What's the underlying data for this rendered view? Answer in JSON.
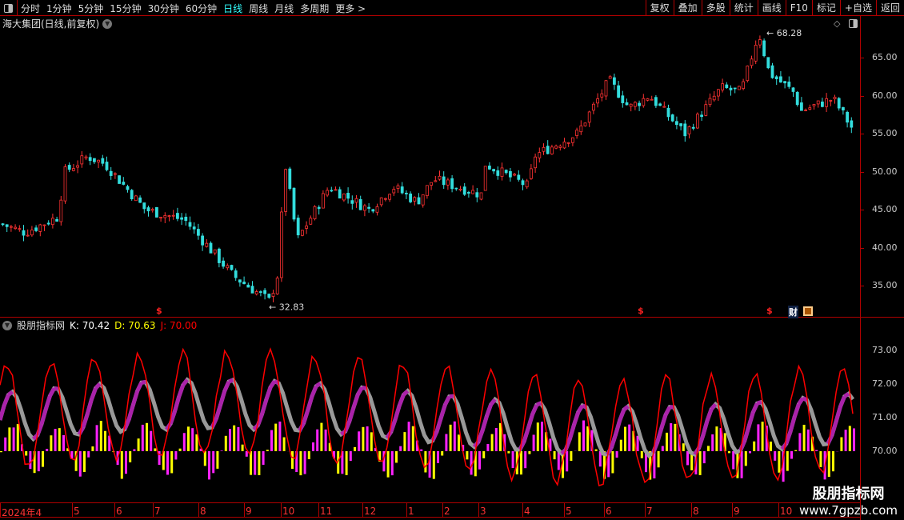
{
  "toolbar": {
    "periods": [
      "分时",
      "1分钟",
      "5分钟",
      "15分钟",
      "30分钟",
      "60分钟",
      "日线",
      "周线",
      "月线",
      "多周期",
      "更多 >"
    ],
    "active": "日线",
    "actions": [
      "复权",
      "叠加",
      "多股",
      "统计",
      "画线",
      "F10",
      "标记",
      "+自选",
      "返回"
    ]
  },
  "chart_title": "海大集团(日线,前复权)",
  "price_axis": [
    "65.00",
    "60.00",
    "55.00",
    "50.00",
    "45.00",
    "40.00",
    "35.00"
  ],
  "annotations": {
    "high": "68.28",
    "low": "32.83"
  },
  "markers": {
    "s": "$",
    "cai": "财"
  },
  "indicator": {
    "name": "股朋指标网",
    "k": "K: 70.42",
    "d": "D: 70.63",
    "j": "J: 70.00",
    "axis": [
      "73.00",
      "72.00",
      "71.00",
      "70.00"
    ]
  },
  "months": [
    "2024年4",
    "5",
    "6",
    "7",
    "8",
    "9",
    "10",
    "11",
    "12",
    "1",
    "2",
    "3",
    "4",
    "5",
    "6",
    "7",
    "8",
    "9",
    "10"
  ],
  "watermark": {
    "name": "股朋指标网",
    "url": "www.7gpzb.com"
  },
  "colors": {
    "up": "#ff3333",
    "down": "#33dddd",
    "k": "#999999",
    "d": "#aa22aa",
    "j": "#ff0000",
    "hist_pos": "#ff22ff",
    "hist_neg": "#ffff00"
  },
  "chart_data": {
    "type": "candlestick",
    "ylim": [
      31,
      69
    ],
    "price_path": [
      43.1,
      42,
      44,
      50,
      52,
      51,
      45,
      43.6,
      36.3,
      33,
      36,
      51,
      41,
      48,
      45,
      48,
      46,
      49,
      47,
      51,
      48,
      52,
      55,
      62,
      58.4,
      60,
      55,
      61,
      60.5,
      68.3,
      63,
      60.5,
      58,
      59.6,
      55.5
    ],
    "high": 68.28,
    "low": 32.83
  }
}
